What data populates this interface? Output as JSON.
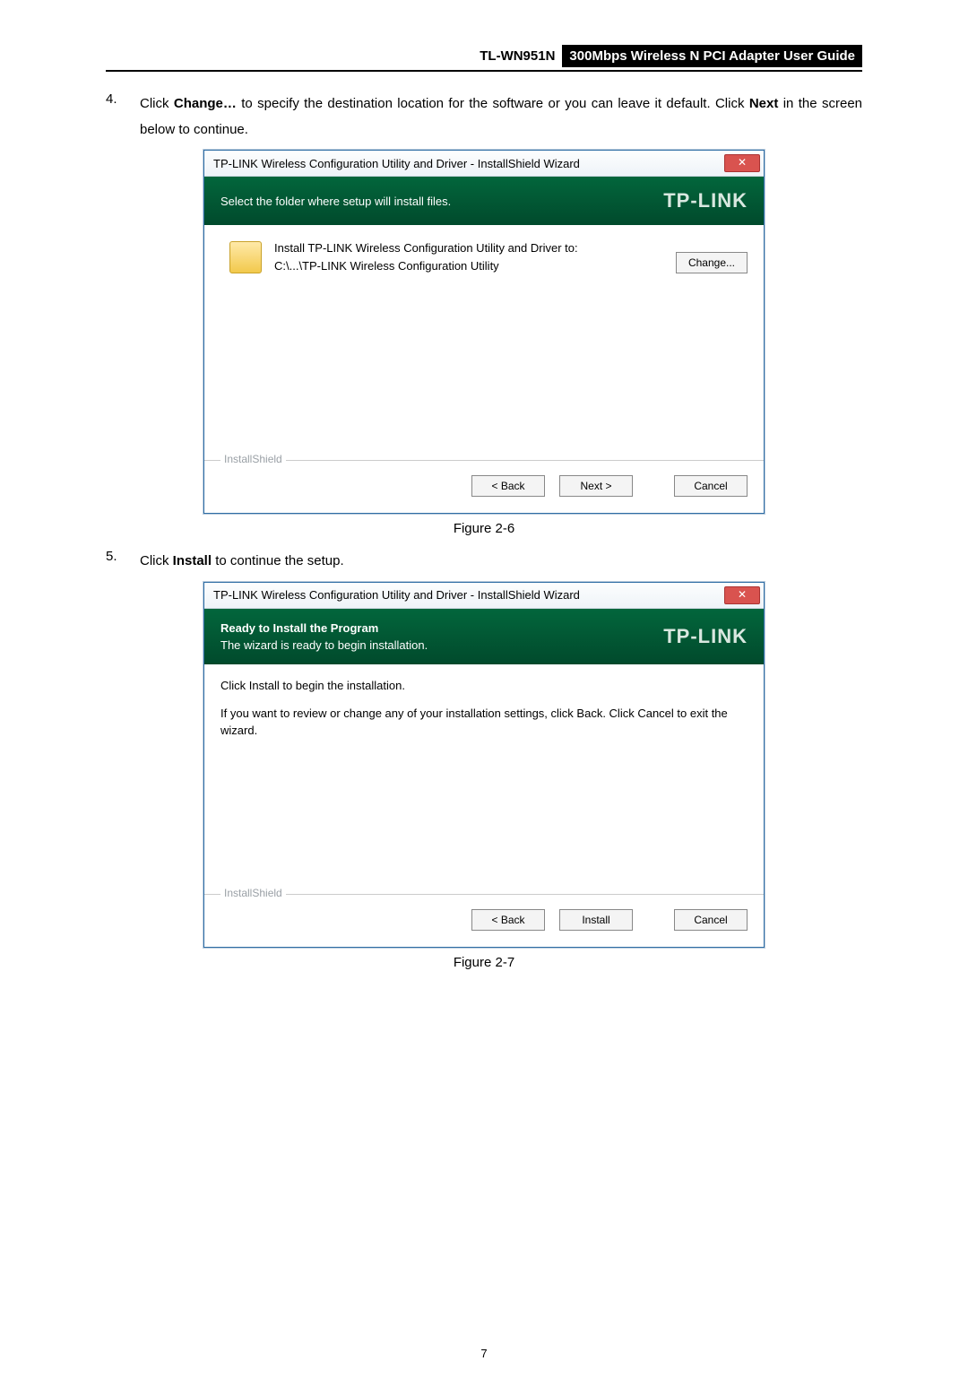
{
  "header": {
    "model": "TL-WN951N",
    "title": "300Mbps Wireless N PCI Adapter User Guide"
  },
  "step4": {
    "num": "4.",
    "pre": "Click ",
    "b1": "Change…",
    "mid": " to specify the destination location for the software or you can leave it default. Click ",
    "b2": "Next",
    "post": " in the screen below to continue."
  },
  "dlg1": {
    "title": "TP-LINK Wireless Configuration Utility and Driver - InstallShield Wizard",
    "close": "✕",
    "panelText": "Select the folder where setup will install files.",
    "logo": "TP-LINK",
    "installTo": "Install TP-LINK Wireless Configuration Utility and Driver to:",
    "path": "C:\\...\\TP-LINK Wireless Configuration Utility",
    "change": "Change...",
    "ishield": "InstallShield",
    "back": "< Back",
    "next": "Next >",
    "cancel": "Cancel"
  },
  "fig1": "Figure 2-6",
  "step5": {
    "num": "5.",
    "pre": "Click ",
    "b1": "Install",
    "post": " to continue the setup."
  },
  "dlg2": {
    "title": "TP-LINK Wireless Configuration Utility and Driver - InstallShield Wizard",
    "close": "✕",
    "panelBold": "Ready to Install the Program",
    "panelText": "The wizard is ready to begin installation.",
    "logo": "TP-LINK",
    "line1": "Click Install to begin the installation.",
    "line2": "If you want to review or change any of your installation settings, click Back. Click Cancel to exit the wizard.",
    "ishield": "InstallShield",
    "back": "< Back",
    "install": "Install",
    "cancel": "Cancel"
  },
  "fig2": "Figure 2-7",
  "pageNumber": "7"
}
